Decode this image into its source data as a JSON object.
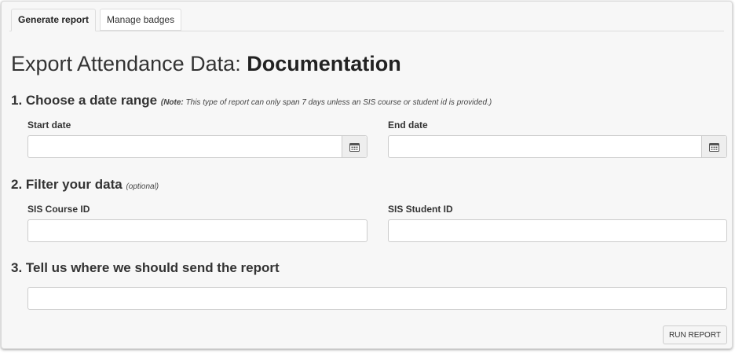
{
  "tabs": [
    {
      "label": "Generate report",
      "active": true
    },
    {
      "label": "Manage badges",
      "active": false
    }
  ],
  "page": {
    "title_prefix": "Export Attendance Data: ",
    "title_bold": "Documentation"
  },
  "section1": {
    "title": "1. Choose a date range",
    "note_label": "(Note:",
    "note_text": " This type of report can only span 7 days unless an SIS course or student id is provided.)",
    "start_label": "Start date",
    "start_value": "",
    "end_label": "End date",
    "end_value": "",
    "calendar_icon": "calendar-icon"
  },
  "section2": {
    "title": "2. Filter your data",
    "optional": "(optional)",
    "course_label": "SIS Course ID",
    "course_value": "",
    "student_label": "SIS Student ID",
    "student_value": ""
  },
  "section3": {
    "title": "3. Tell us where we should send the report",
    "email_value": ""
  },
  "actions": {
    "run_label": "RUN REPORT"
  }
}
